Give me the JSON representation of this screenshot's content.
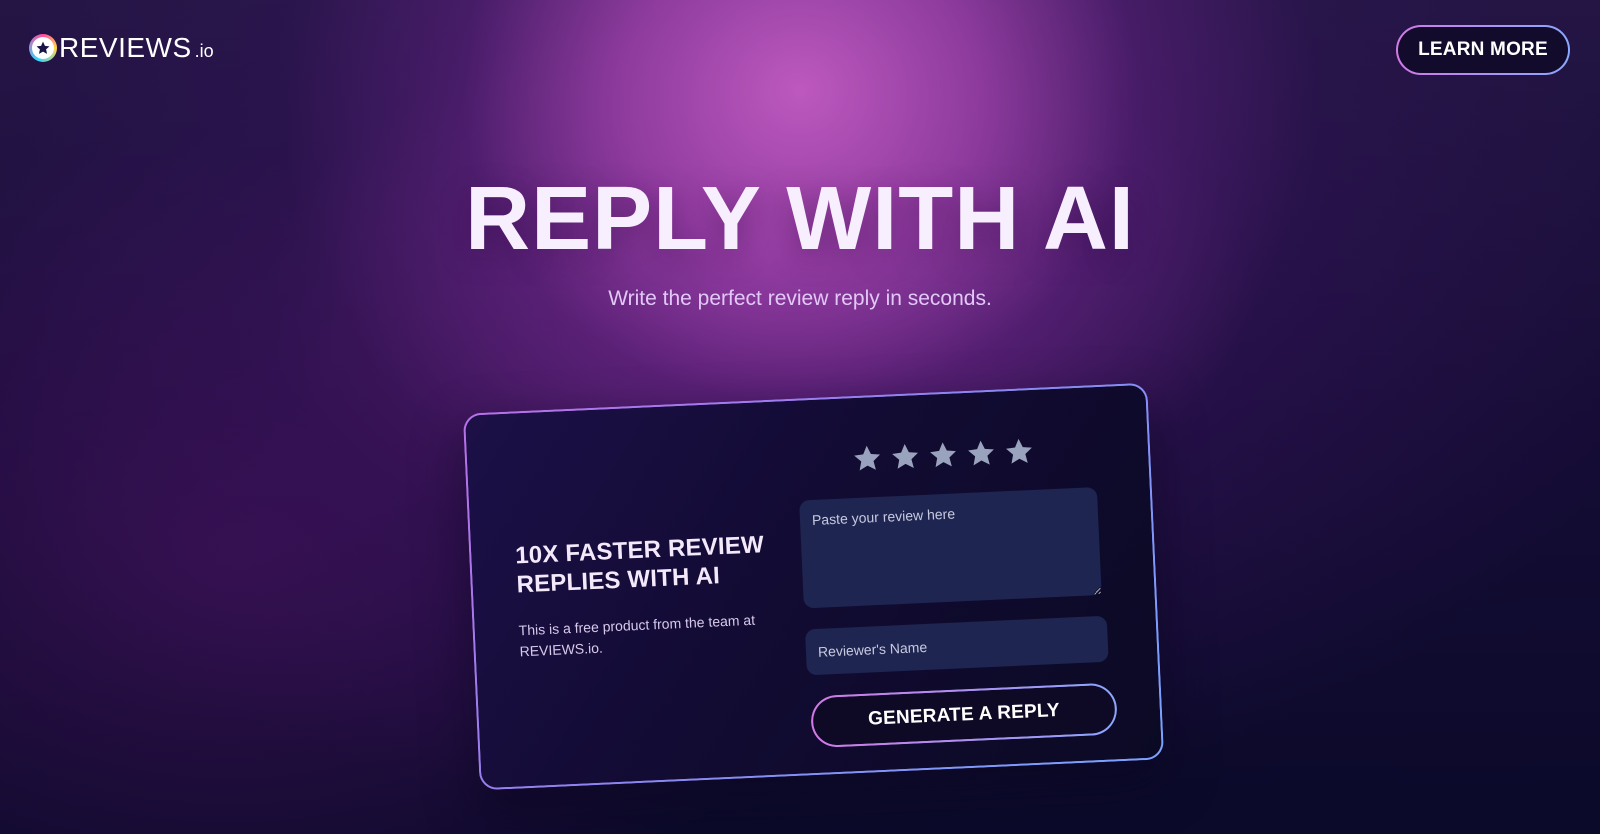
{
  "header": {
    "logo_text": "REVIEWS",
    "logo_suffix": ".io",
    "learn_more_label": "LEARN MORE"
  },
  "hero": {
    "title": "REPLY WITH AI",
    "subtitle": "Write the perfect review reply in seconds."
  },
  "card": {
    "headline": "10X FASTER REVIEW REPLIES WITH AI",
    "description": "This is a free product from the team at REVIEWS.io.",
    "rating": {
      "max": 5,
      "selected": 0,
      "icon": "star-icon",
      "color": "#9aa3bd"
    },
    "review_placeholder": "Paste your review here",
    "review_value": "",
    "name_placeholder": "Reviewer's Name",
    "name_value": "",
    "generate_label": "GENERATE A REPLY"
  },
  "colors": {
    "accent_gradient_start": "#d279e6",
    "accent_gradient_end": "#8ba6ff",
    "input_bg": "#1e2550",
    "card_bg": "#120b33"
  }
}
